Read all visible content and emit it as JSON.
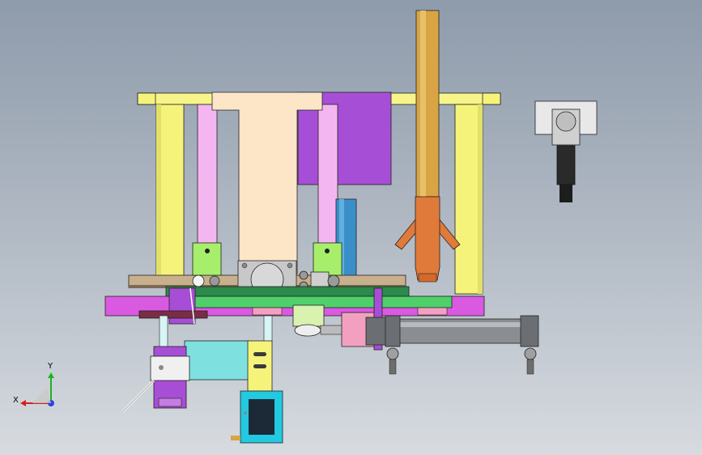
{
  "viewport": {
    "background_top": "#8e9bab",
    "background_bottom": "#d7dbe0"
  },
  "triad": {
    "x_label": "X",
    "y_label": "Y",
    "x_color": "#d81e1e",
    "y_color": "#1fb31f",
    "z_color": "#2747d6"
  },
  "palette": {
    "frame_yellow": "#f5f37a",
    "top_bar_yellow": "#f7f58a",
    "pink_column": "#f4b6f0",
    "beige_body": "#fde5c8",
    "purple_plate": "#a74ed6",
    "magenta_base": "#d95ae0",
    "green_rail": "#4fd06a",
    "tan_plate": "#c9b08c",
    "orange_pipe": "#e07a3a",
    "gold_tube": "#d9a443",
    "blue_cylinder": "#3b8fc8",
    "cyan_block": "#7fe0e0",
    "lime_bracket": "#a7ee6a",
    "steel_grey": "#8a8d91",
    "motor_cyan": "#22c9e0"
  },
  "components": [
    "frame-left-upright",
    "frame-right-upright",
    "top-crossbar",
    "center-beige-body",
    "purple-back-plate",
    "orange-vertical-pipe",
    "gold-feed-tube",
    "blue-cylinder",
    "magenta-base-plate",
    "green-rail",
    "horizontal-air-cylinder",
    "stepper-motor",
    "sensor-bracket",
    "camera-sensor"
  ]
}
